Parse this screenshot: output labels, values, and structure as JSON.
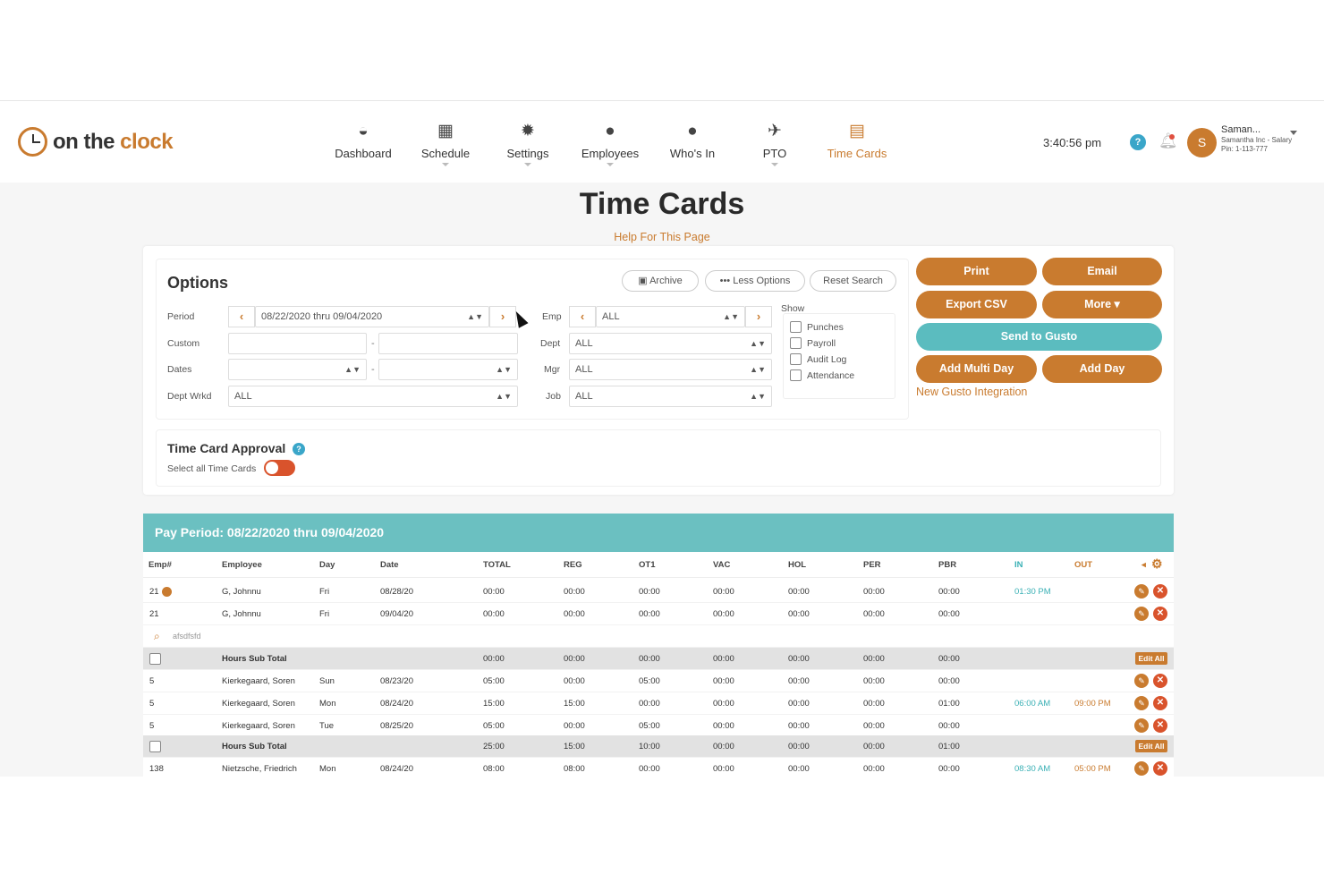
{
  "logo": {
    "part1": "on the",
    "part2": "clock"
  },
  "nav": {
    "items": [
      {
        "label": "Dashboard",
        "icon": "dashboard-icon",
        "glyph": "◒"
      },
      {
        "label": "Schedule",
        "icon": "schedule-icon",
        "glyph": "▦"
      },
      {
        "label": "Settings",
        "icon": "settings-icon",
        "glyph": "✹"
      },
      {
        "label": "Employees",
        "icon": "employees-icon",
        "glyph": "●"
      },
      {
        "label": "Who's In",
        "icon": "whos-in-icon",
        "glyph": "●"
      },
      {
        "label": "PTO",
        "icon": "airplane-icon",
        "glyph": "✈"
      },
      {
        "label": "Time Cards",
        "icon": "time-cards-icon",
        "glyph": "▤"
      }
    ]
  },
  "header": {
    "time": "3:40:56 pm",
    "help_glyph": "?",
    "avatar_initial": "S",
    "user_name": "Saman...",
    "user_company": "Samantha Inc - Salary",
    "user_pin": "Pin: 1-113-777"
  },
  "page": {
    "title": "Time Cards",
    "help_link": "Help For This Page"
  },
  "options": {
    "title": "Options",
    "archive_label": "Archive",
    "less_options_label": "••• Less Options",
    "reset_label": "Reset Search",
    "period_label": "Period",
    "period_value": "08/22/2020 thru 09/04/2020",
    "custom_label": "Custom",
    "dates_label": "Dates",
    "dept_wrkd_label": "Dept Wrkd",
    "dept_wrkd_value": "ALL",
    "emp_label": "Emp",
    "emp_value": "ALL",
    "dept_label": "Dept",
    "dept_value": "ALL",
    "mgr_label": "Mgr",
    "mgr_value": "ALL",
    "job_label": "Job",
    "job_value": "ALL",
    "show_label": "Show",
    "show_items": [
      "Punches",
      "Payroll",
      "Audit Log",
      "Attendance"
    ]
  },
  "actions": {
    "print": "Print",
    "email": "Email",
    "export_csv": "Export CSV",
    "more": "More",
    "send_to_gusto": "Send to Gusto",
    "add_multi_day": "Add Multi Day",
    "add_day": "Add Day",
    "gusto_link": "New Gusto Integration"
  },
  "approval": {
    "title": "Time Card Approval",
    "select_all": "Select all Time Cards"
  },
  "table": {
    "pay_period": "Pay Period: 08/22/2020 thru 09/04/2020",
    "columns": [
      "Emp#",
      "Employee",
      "Day",
      "Date",
      "TOTAL",
      "REG",
      "OT1",
      "VAC",
      "HOL",
      "PER",
      "PBR",
      "IN",
      "OUT"
    ],
    "rows": [
      {
        "kind": "data",
        "emp": "21",
        "name": "G, Johnnu",
        "day": "Fri",
        "date": "08/28/20",
        "total": "00:00",
        "reg": "00:00",
        "ot1": "00:00",
        "vac": "00:00",
        "hol": "00:00",
        "per": "00:00",
        "pbr": "00:00",
        "in": "01:30 PM",
        "out": "",
        "note": true
      },
      {
        "kind": "data",
        "emp": "21",
        "name": "G, Johnnu",
        "day": "Fri",
        "date": "09/04/20",
        "total": "00:00",
        "reg": "00:00",
        "ot1": "00:00",
        "vac": "00:00",
        "hol": "00:00",
        "per": "00:00",
        "pbr": "00:00",
        "in": "",
        "out": ""
      },
      {
        "kind": "note",
        "text": "afsdfsfd"
      },
      {
        "kind": "subtotal",
        "label": "Hours Sub Total",
        "total": "00:00",
        "reg": "00:00",
        "ot1": "00:00",
        "vac": "00:00",
        "hol": "00:00",
        "per": "00:00",
        "pbr": "00:00"
      },
      {
        "kind": "data",
        "emp": "5",
        "name": "Kierkegaard, Soren",
        "day": "Sun",
        "date": "08/23/20",
        "total": "05:00",
        "reg": "00:00",
        "ot1": "05:00",
        "vac": "00:00",
        "hol": "00:00",
        "per": "00:00",
        "pbr": "00:00",
        "in": "",
        "out": ""
      },
      {
        "kind": "data",
        "emp": "5",
        "name": "Kierkegaard, Soren",
        "day": "Mon",
        "date": "08/24/20",
        "total": "15:00",
        "reg": "15:00",
        "ot1": "00:00",
        "vac": "00:00",
        "hol": "00:00",
        "per": "00:00",
        "pbr": "01:00",
        "in": "06:00 AM",
        "out": "09:00 PM"
      },
      {
        "kind": "data",
        "emp": "5",
        "name": "Kierkegaard, Soren",
        "day": "Tue",
        "date": "08/25/20",
        "total": "05:00",
        "reg": "00:00",
        "ot1": "05:00",
        "vac": "00:00",
        "hol": "00:00",
        "per": "00:00",
        "pbr": "00:00",
        "in": "",
        "out": ""
      },
      {
        "kind": "subtotal",
        "label": "Hours Sub Total",
        "total": "25:00",
        "reg": "15:00",
        "ot1": "10:00",
        "vac": "00:00",
        "hol": "00:00",
        "per": "00:00",
        "pbr": "01:00"
      },
      {
        "kind": "data",
        "emp": "138",
        "name": "Nietzsche, Friedrich",
        "day": "Mon",
        "date": "08/24/20",
        "total": "08:00",
        "reg": "08:00",
        "ot1": "00:00",
        "vac": "00:00",
        "hol": "00:00",
        "per": "00:00",
        "pbr": "00:00",
        "in": "08:30 AM",
        "out": "05:00 PM"
      }
    ],
    "edit_all_label": "Edit All"
  },
  "colors": {
    "brand": "#c97b2f",
    "teal": "#6bc0c1",
    "danger": "#d9532c",
    "info": "#3aa6c9"
  }
}
